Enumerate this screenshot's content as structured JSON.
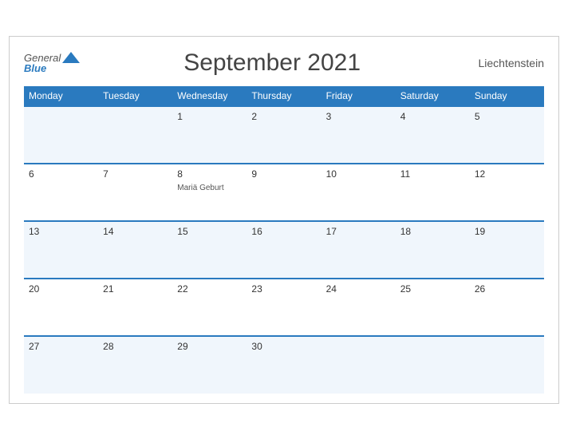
{
  "header": {
    "logo_general": "General",
    "logo_blue": "Blue",
    "month_title": "September 2021",
    "country": "Liechtenstein"
  },
  "days_of_week": [
    "Monday",
    "Tuesday",
    "Wednesday",
    "Thursday",
    "Friday",
    "Saturday",
    "Sunday"
  ],
  "weeks": [
    [
      {
        "day": "",
        "event": ""
      },
      {
        "day": "",
        "event": ""
      },
      {
        "day": "1",
        "event": ""
      },
      {
        "day": "2",
        "event": ""
      },
      {
        "day": "3",
        "event": ""
      },
      {
        "day": "4",
        "event": ""
      },
      {
        "day": "5",
        "event": ""
      }
    ],
    [
      {
        "day": "6",
        "event": ""
      },
      {
        "day": "7",
        "event": ""
      },
      {
        "day": "8",
        "event": "Mariä Geburt"
      },
      {
        "day": "9",
        "event": ""
      },
      {
        "day": "10",
        "event": ""
      },
      {
        "day": "11",
        "event": ""
      },
      {
        "day": "12",
        "event": ""
      }
    ],
    [
      {
        "day": "13",
        "event": ""
      },
      {
        "day": "14",
        "event": ""
      },
      {
        "day": "15",
        "event": ""
      },
      {
        "day": "16",
        "event": ""
      },
      {
        "day": "17",
        "event": ""
      },
      {
        "day": "18",
        "event": ""
      },
      {
        "day": "19",
        "event": ""
      }
    ],
    [
      {
        "day": "20",
        "event": ""
      },
      {
        "day": "21",
        "event": ""
      },
      {
        "day": "22",
        "event": ""
      },
      {
        "day": "23",
        "event": ""
      },
      {
        "day": "24",
        "event": ""
      },
      {
        "day": "25",
        "event": ""
      },
      {
        "day": "26",
        "event": ""
      }
    ],
    [
      {
        "day": "27",
        "event": ""
      },
      {
        "day": "28",
        "event": ""
      },
      {
        "day": "29",
        "event": ""
      },
      {
        "day": "30",
        "event": ""
      },
      {
        "day": "",
        "event": ""
      },
      {
        "day": "",
        "event": ""
      },
      {
        "day": "",
        "event": ""
      }
    ]
  ]
}
